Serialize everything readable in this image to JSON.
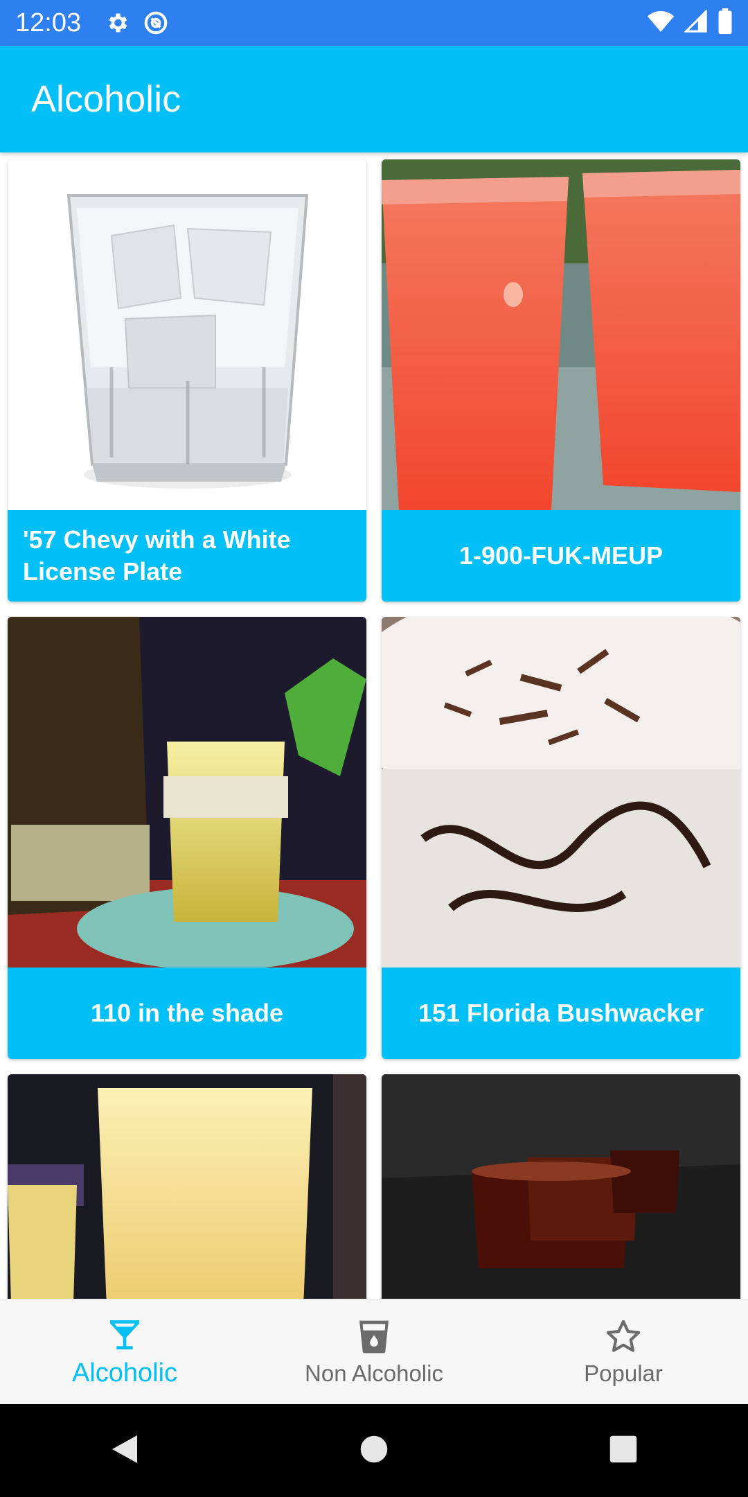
{
  "status_bar": {
    "time": "12:03",
    "icons": [
      "gear-icon",
      "data-saver-icon",
      "wifi-icon",
      "signal-icon",
      "battery-icon"
    ]
  },
  "app_bar": {
    "title": "Alcoholic"
  },
  "drinks": [
    {
      "name": "'57 Chevy with a White License Plate"
    },
    {
      "name": "1-900-FUK-MEUP"
    },
    {
      "name": "110 in the shade"
    },
    {
      "name": "151 Florida Bushwacker"
    },
    {
      "name": ""
    },
    {
      "name": ""
    }
  ],
  "bottom_nav": {
    "items": [
      {
        "label": "Alcoholic",
        "icon": "cocktail-glass-icon",
        "active": true
      },
      {
        "label": "Non Alcoholic",
        "icon": "cup-icon",
        "active": false
      },
      {
        "label": "Popular",
        "icon": "star-outline-icon",
        "active": false
      }
    ]
  },
  "colors": {
    "status_bar": "#2e7ff0",
    "primary": "#00bff7",
    "nav_background": "#f7f7f7",
    "inactive_label": "#6b6b6b"
  }
}
